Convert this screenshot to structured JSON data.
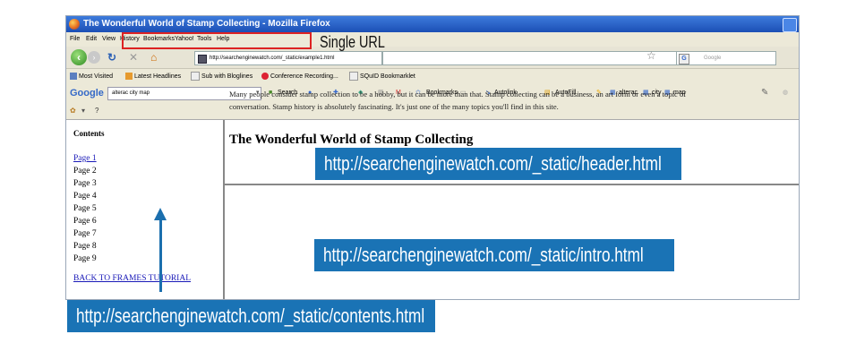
{
  "window": {
    "title": "The Wonderful World of Stamp Collecting - Mozilla Firefox"
  },
  "menu": [
    "File",
    "Edit",
    "View",
    "History",
    "Bookmarks",
    "Yahoo!",
    "Tools",
    "Help"
  ],
  "nav": {
    "url": "http://searchenginewatch.com/_static/example1.html",
    "search_placeholder": "Google",
    "search_engine_icon": "G"
  },
  "annotation_single_url": "Single URL",
  "bookmarks": [
    "Most Visited",
    "Latest Headlines",
    "Sub with Bloglines",
    "Conference Recording...",
    "SQuID Bookmarklet"
  ],
  "google_toolbar": {
    "logo": "Google",
    "query": "alterac city map",
    "items": [
      "Search",
      "Bookmarks",
      "Autolink",
      "AutoFill",
      "alterac",
      "city",
      "map"
    ]
  },
  "second_toolbar": {
    "help": "?"
  },
  "contents_frame": {
    "heading": "Contents",
    "pages": [
      "Page 1",
      "Page 2",
      "Page 3",
      "Page 4",
      "Page 5",
      "Page 6",
      "Page 7",
      "Page 8",
      "Page 9"
    ],
    "back_link": "BACK TO FRAMES TUTORIAL"
  },
  "header_frame": {
    "title": "The Wonderful World of Stamp Collecting"
  },
  "intro_frame": {
    "line1": "Many people consider stamp collection to be a hobby, but it can be more than that. Stamp collecting can be a business, an art form or even a topic of",
    "line2": "conversation. Stamp history is absolutely fascinating. It's just one of the many topics you'll find in this site."
  },
  "callouts": {
    "header": "http://searchenginewatch.com/_static/header.html",
    "intro": "http://searchenginewatch.com/_static/intro.html",
    "contents": "http://searchenginewatch.com/_static/contents.html"
  },
  "colors": {
    "callout_bg": "#1a73b5",
    "highlight_border": "#dd2222",
    "link": "#1a1ab8"
  }
}
